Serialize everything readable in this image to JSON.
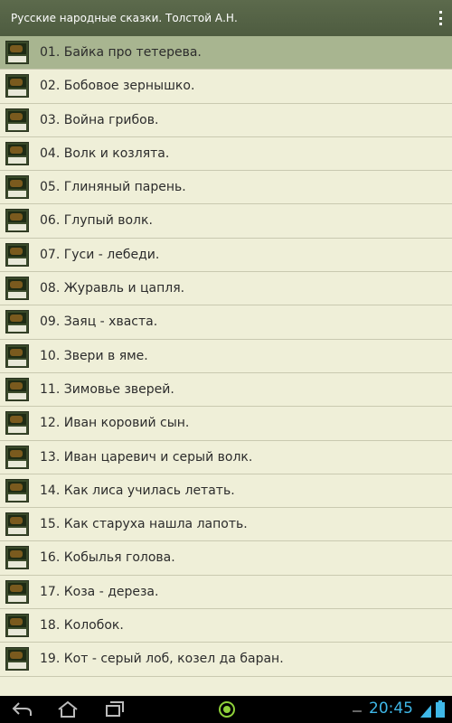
{
  "app_bar": {
    "title": "Русские народные сказки. Толстой А.Н.",
    "menu_icon": "overflow-menu-icon"
  },
  "list": {
    "selected_index": 0,
    "items": [
      {
        "label": "01. Байка про тетерева."
      },
      {
        "label": "02. Бобовое зернышко."
      },
      {
        "label": "03. Война грибов."
      },
      {
        "label": "04. Волк и козлята."
      },
      {
        "label": "05. Глиняный парень."
      },
      {
        "label": "06. Глупый волк."
      },
      {
        "label": "07. Гуси - лебеди."
      },
      {
        "label": "08. Журавль и цапля."
      },
      {
        "label": "09. Заяц - хваста."
      },
      {
        "label": "10. Звери в яме."
      },
      {
        "label": "11. Зимовье зверей."
      },
      {
        "label": "12. Иван коровий сын."
      },
      {
        "label": "13. Иван царевич и серый волк."
      },
      {
        "label": "14. Как лиса училась летать."
      },
      {
        "label": "15. Как старуха нашла лапоть."
      },
      {
        "label": "16. Кобылья голова."
      },
      {
        "label": "17. Коза - дереза."
      },
      {
        "label": "18. Колобок."
      },
      {
        "label": "19. Кот - серый лоб, козел да баран."
      }
    ]
  },
  "system_bar": {
    "time": "20:45",
    "icons": [
      "back-icon",
      "home-icon",
      "recent-apps-icon",
      "app-indicator-icon",
      "usb-icon",
      "wifi-icon",
      "battery-icon"
    ]
  },
  "colors": {
    "app_bar": "#56644a",
    "list_bg": "#efefd8",
    "selected_row": "#a8b590",
    "clock": "#3fb8e8"
  }
}
